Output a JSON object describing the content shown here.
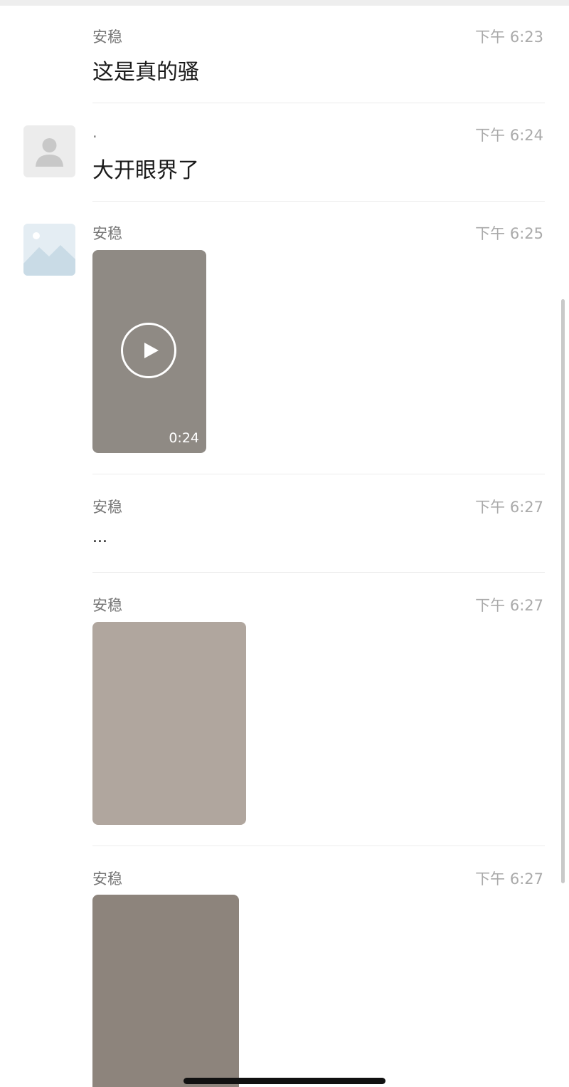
{
  "messages": [
    {
      "sender": "安稳",
      "time": "下午 6:23",
      "text": "这是真的骚"
    },
    {
      "sender": ".",
      "time": "下午 6:24",
      "text": "大开眼界了"
    },
    {
      "sender": "安稳",
      "time": "下午 6:25",
      "video_duration": "0:24"
    },
    {
      "sender": "安稳",
      "time": "下午 6:27",
      "text": "..."
    },
    {
      "sender": "安稳",
      "time": "下午 6:27"
    },
    {
      "sender": "安稳",
      "time": "下午 6:27"
    }
  ],
  "colors": {
    "background": "#ffffff",
    "sender": "#777777",
    "time": "#aaaaaa",
    "text": "#1a1a1a",
    "divider": "#ececec"
  }
}
